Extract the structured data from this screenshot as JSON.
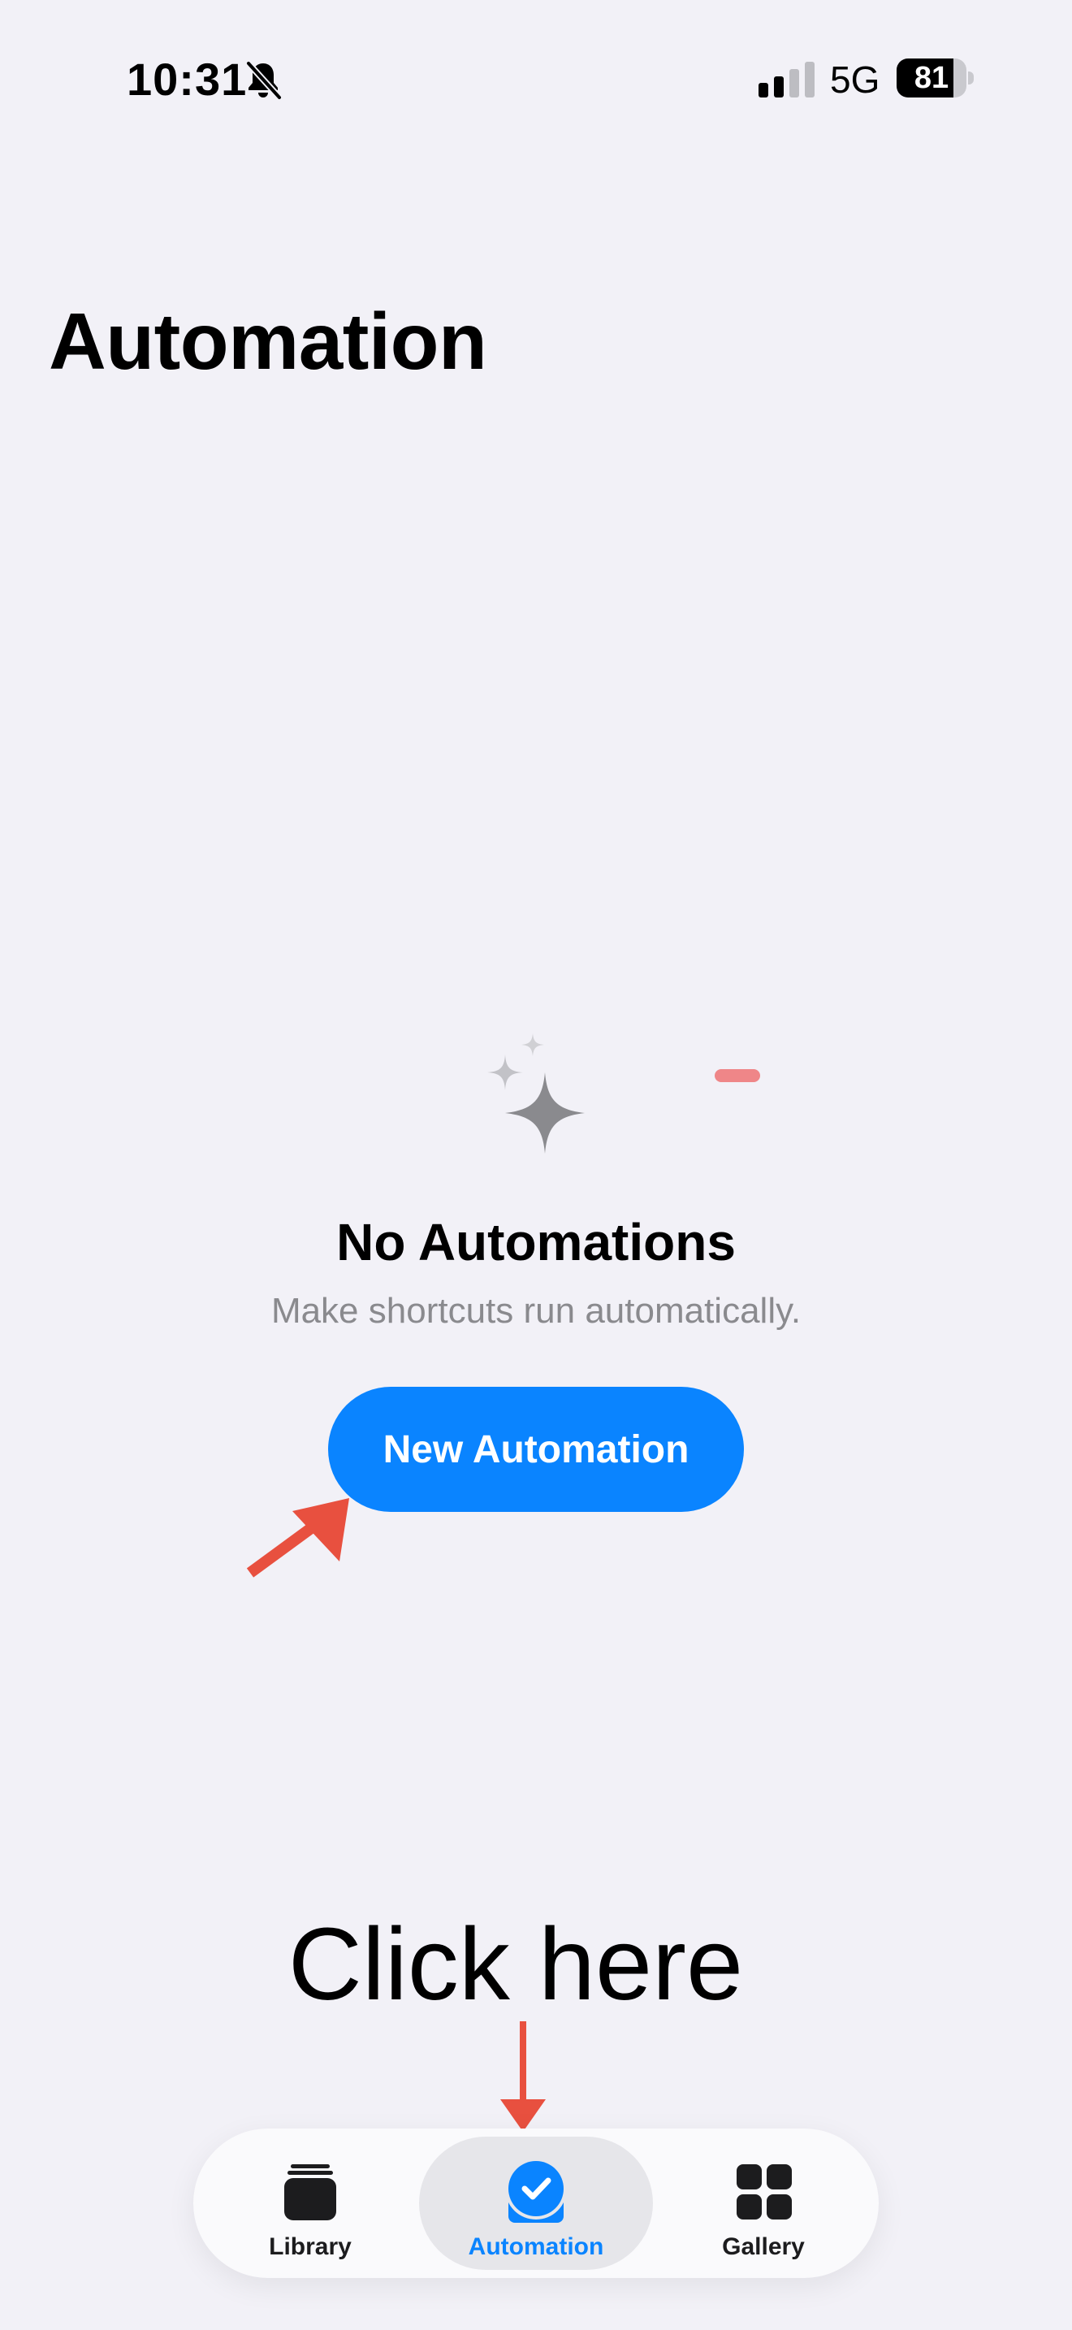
{
  "status_bar": {
    "time": "10:31",
    "network": "5G",
    "battery_level": "81",
    "battery_fraction": 0.81,
    "icons": [
      "bell-slash-icon",
      "cellular-signal-icon",
      "battery-icon"
    ]
  },
  "page": {
    "title": "Automation"
  },
  "empty_state": {
    "icon": "sparkles-icon",
    "title": "No Automations",
    "subtitle": "Make shortcuts run automatically.",
    "button_label": "New Automation"
  },
  "annotations": {
    "click_here": "Click here",
    "arrow_color": "#e8503f"
  },
  "tab_bar": {
    "tabs": [
      {
        "label": "Library",
        "icon": "stack-icon",
        "selected": false
      },
      {
        "label": "Automation",
        "icon": "checkmark-circle-icon",
        "selected": true
      },
      {
        "label": "Gallery",
        "icon": "grid-icon",
        "selected": false
      }
    ]
  },
  "colors": {
    "accent": "#0a84ff",
    "background": "#f2f1f7",
    "secondary_text": "#8a8a8e"
  }
}
